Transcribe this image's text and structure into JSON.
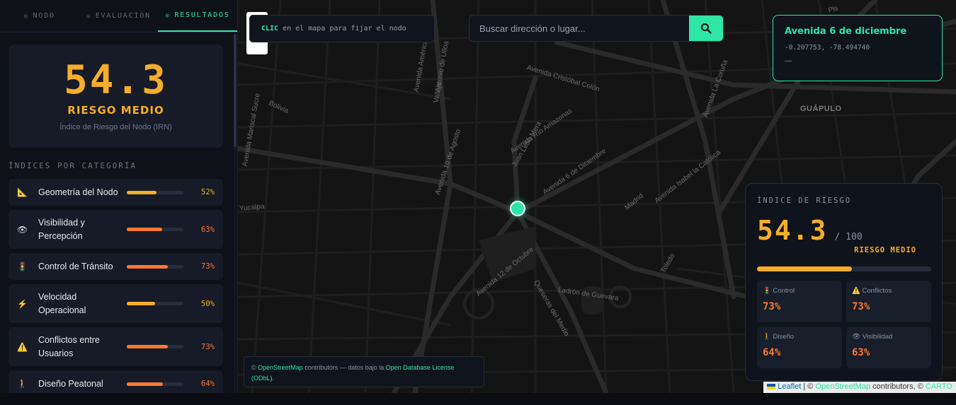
{
  "tabs": [
    {
      "label": "NODO",
      "active": false
    },
    {
      "label": "EVALUACIÓN",
      "active": false
    },
    {
      "label": "RESULTADOS",
      "active": true
    }
  ],
  "score_card": {
    "value": "54.3",
    "level": "RIESGO MEDIO",
    "caption": "Índice de Riesgo del Nodo (IRN)"
  },
  "categories_title": "ÍNDICES POR CATEGORÍA",
  "categories": [
    {
      "icon": "triangle-ruler-icon",
      "glyph": "📐",
      "name": "Geometría del Nodo",
      "value": "52%",
      "fraction": 0.52,
      "color": "#f5ad2a"
    },
    {
      "icon": "eye-icon",
      "glyph": "👁",
      "name": "Visibilidad y Percepción",
      "value": "63%",
      "fraction": 0.63,
      "color": "#fb7834"
    },
    {
      "icon": "traffic-light-icon",
      "glyph": "🚦",
      "name": "Control de Tránsito",
      "value": "73%",
      "fraction": 0.73,
      "color": "#fb7834"
    },
    {
      "icon": "lightning-icon",
      "glyph": "⚡",
      "name": "Velocidad Operacional",
      "value": "50%",
      "fraction": 0.5,
      "color": "#f5ad2a"
    },
    {
      "icon": "warning-icon",
      "glyph": "⚠️",
      "name": "Conflictos entre Usuarios",
      "value": "73%",
      "fraction": 0.73,
      "color": "#fb7834"
    },
    {
      "icon": "pedestrian-icon",
      "glyph": "🚶",
      "name": "Diseño Peatonal",
      "value": "64%",
      "fraction": 0.64,
      "color": "#fb7834"
    }
  ],
  "map": {
    "hint_strong": "CLIC",
    "hint_text": "en el mapa para fijar el nodo",
    "search_placeholder": "Buscar dirección o lugar...",
    "street_labels": [
      "Avenida América",
      "Antonio de Ulloa",
      "Vallejo",
      "Avenida Cristóbal Colón",
      "Avenida Río Amazonas",
      "Juan León Mera",
      "Avenida 6 de Diciembre",
      "Avenida 10 de Agosto",
      "Avenida 12 de Octubre",
      "Ladrón de Guevara",
      "Queseras del Medio",
      "Toledo",
      "Madrid",
      "Avenida Isabel la Católica",
      "Avenida La Coruña",
      "Bolivia",
      "Avenida Mariscal Sucre",
      "Pls",
      "Yucalpa"
    ],
    "district_label": "GUÁPULO"
  },
  "location": {
    "title": "Avenida 6 de diciembre",
    "coords": "-0.207753, -78.494740",
    "extra": "—"
  },
  "risk_panel": {
    "title": "ÍNDICE DE RIESGO",
    "score": "54.3",
    "max": "/ 100",
    "level": "RIESGO MEDIO",
    "fraction": 0.543,
    "color": "#f5ad2a",
    "metrics": [
      {
        "icon": "traffic-light-icon",
        "glyph": "🚦",
        "label": "Control",
        "value": "73%"
      },
      {
        "icon": "warning-icon",
        "glyph": "⚠️",
        "label": "Conflictos",
        "value": "73%"
      },
      {
        "icon": "pedestrian-icon",
        "glyph": "🚶",
        "label": "Diseño",
        "value": "64%"
      },
      {
        "icon": "eye-icon",
        "glyph": "👁",
        "label": "Visibilidad",
        "value": "63%"
      }
    ]
  },
  "attribution": {
    "prefix": "©",
    "osm": "OpenStreetMap",
    "mid": "contributors — datos bajo la",
    "odbl": "Open Database License (ODbL)."
  },
  "leaflet_attr": {
    "leaflet": "Leaflet",
    "sep1": "| ©",
    "osm": "OpenStreetMap",
    "mid": "contributors, ©",
    "carto": "CARTO"
  },
  "colors": {
    "accent": "#2ee6a6",
    "medium": "#f5ad2a",
    "high": "#fb7834"
  }
}
